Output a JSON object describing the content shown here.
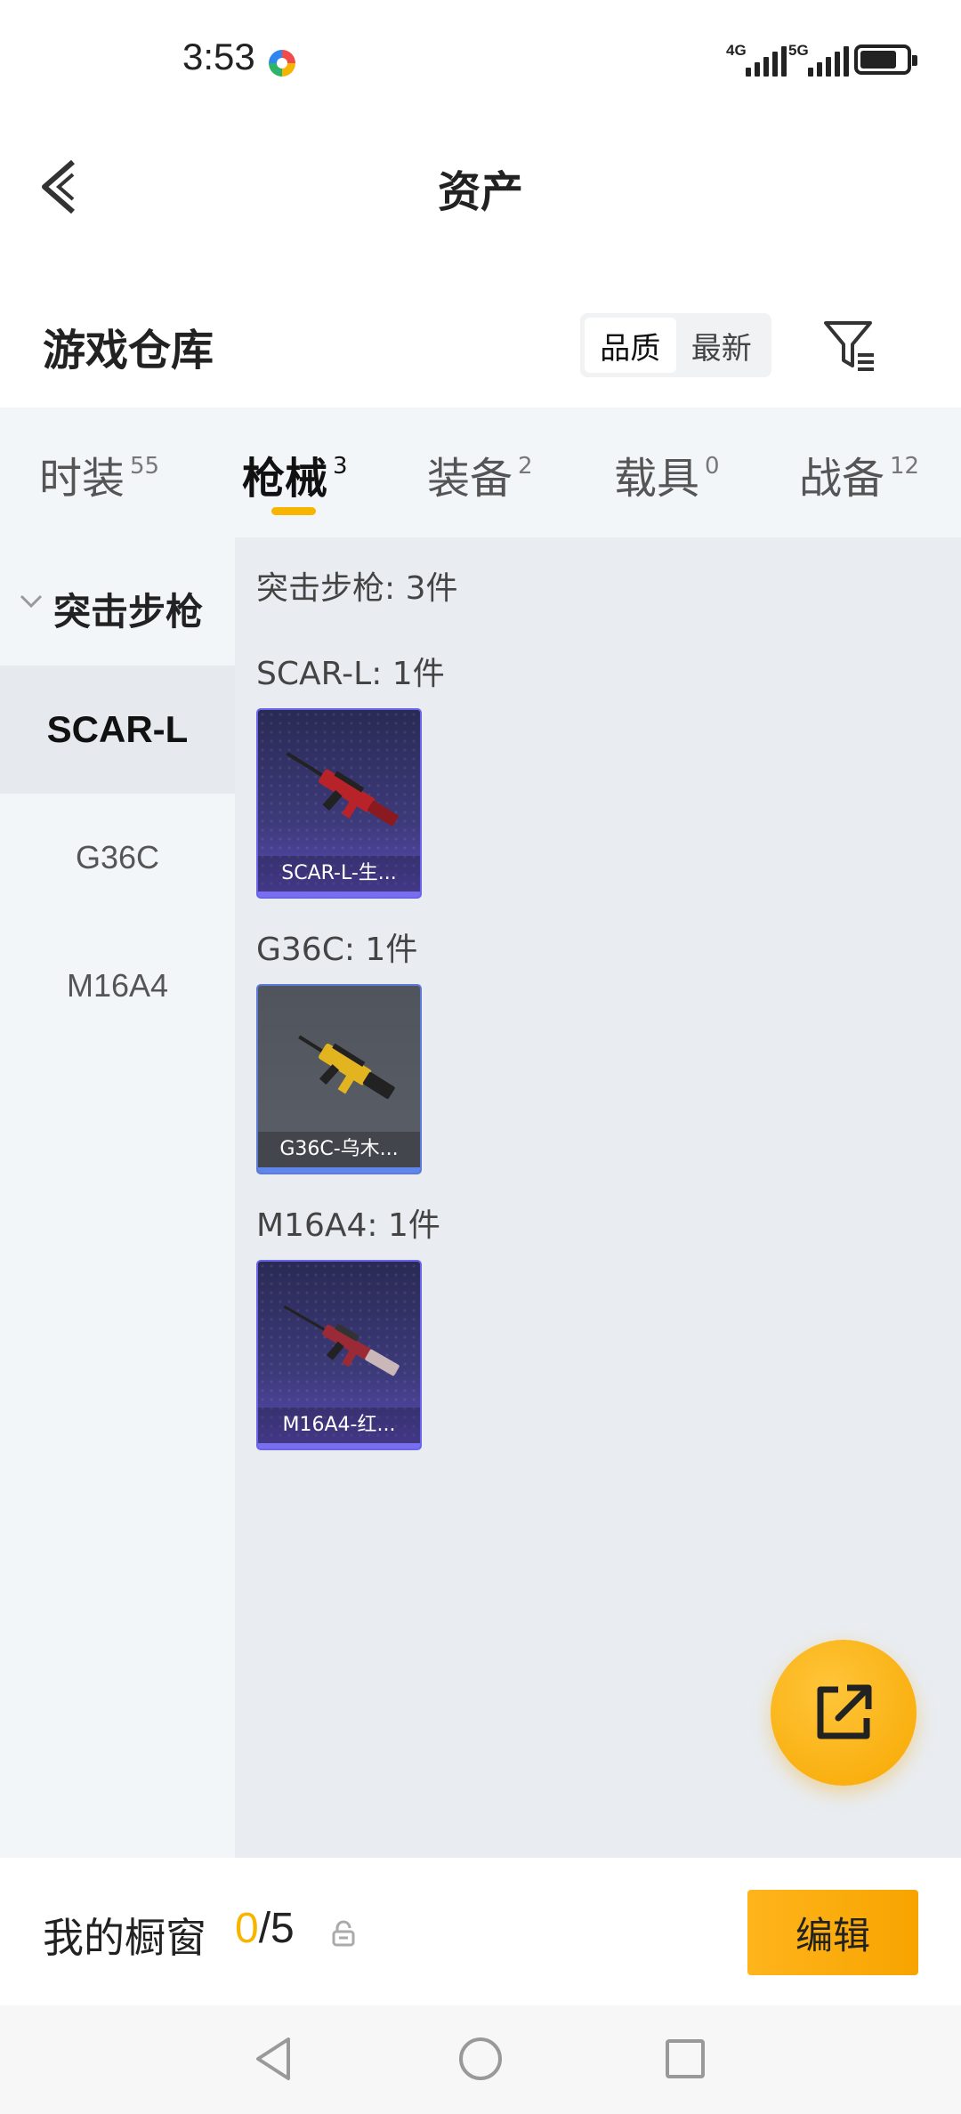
{
  "status_bar": {
    "time": "3:53",
    "network_1": "4G",
    "network_2": "5G"
  },
  "header": {
    "title": "资产"
  },
  "warehouse": {
    "title": "游戏仓库",
    "sort_options": [
      "品质",
      "最新"
    ],
    "sort_selected": "品质"
  },
  "tabs": [
    {
      "label": "时装",
      "count": "55"
    },
    {
      "label": "枪械",
      "count": "3"
    },
    {
      "label": "装备",
      "count": "2"
    },
    {
      "label": "载具",
      "count": "0"
    },
    {
      "label": "战备",
      "count": "12"
    }
  ],
  "active_tab": "枪械",
  "sidebar": {
    "category": "突击步枪",
    "items": [
      "SCAR-L",
      "G36C",
      "M16A4"
    ],
    "selected": "SCAR-L"
  },
  "content": {
    "summary": "突击步枪: 3件",
    "groups": [
      {
        "title": "SCAR-L: 1件",
        "item_label": "SCAR-L-生...",
        "rarity": "purple"
      },
      {
        "title": "G36C: 1件",
        "item_label": "G36C-乌木...",
        "rarity": "gray"
      },
      {
        "title": "M16A4: 1件",
        "item_label": "M16A4-红...",
        "rarity": "purple"
      }
    ]
  },
  "bottom_bar": {
    "showcase_label": "我的橱窗",
    "count_current": "0",
    "count_total": "/5",
    "edit_label": "编辑"
  },
  "colors": {
    "accent": "#f7b500",
    "tab_bg": "#f3f6f9",
    "content_bg": "#e9edf1",
    "rarity_purple": "#7a6ef0",
    "rarity_blue": "#5f86e8"
  },
  "icons": {
    "back": "back-arrow-icon",
    "filter": "filter-icon",
    "share": "share-external-icon",
    "lock": "lock-icon",
    "chevron": "chevron-down-icon"
  }
}
